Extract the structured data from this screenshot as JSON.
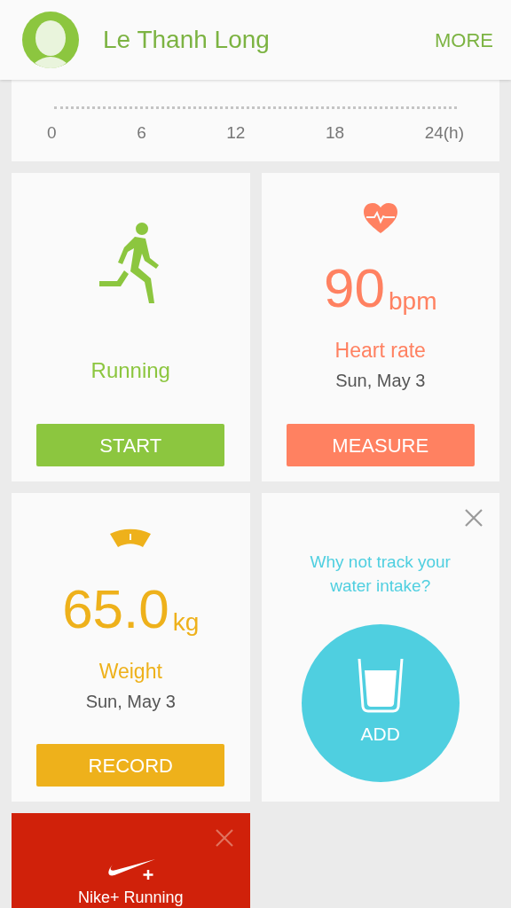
{
  "header": {
    "user_name": "Le Thanh Long",
    "more_label": "MORE"
  },
  "timeline": {
    "ticks": [
      "0",
      "6",
      "12",
      "18",
      "24(h)"
    ]
  },
  "cards": [
    {
      "kind": "activity",
      "label": "Running",
      "button": "START",
      "color": "#8cc63f"
    },
    {
      "kind": "heartrate",
      "value": "90",
      "unit": "bpm",
      "label": "Heart rate",
      "date": "Sun, May 3",
      "button": "MEASURE",
      "color": "#ff8161"
    },
    {
      "kind": "weight",
      "value": "65.0",
      "unit": "kg",
      "label": "Weight",
      "date": "Sun, May 3",
      "button": "RECORD",
      "color": "#eeb11b"
    },
    {
      "kind": "prompt",
      "message": "Why not track your water intake?",
      "button": "ADD",
      "color": "#4fcfe0",
      "dismissible": true
    },
    {
      "kind": "partner",
      "label": "Nike+ Running",
      "color": "#d0210a",
      "dismissible": true
    }
  ]
}
